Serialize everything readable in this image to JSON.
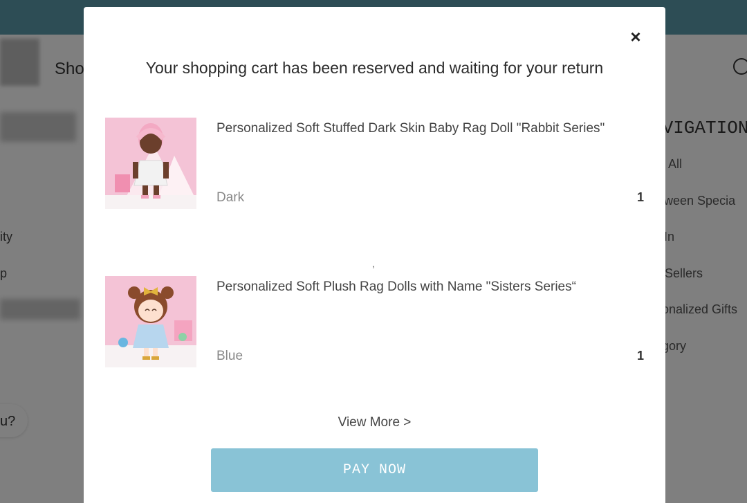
{
  "background": {
    "shop_label": "Sho",
    "left_links": [
      "ity",
      "p"
    ],
    "chat_text": "u?",
    "nav_heading": "AVIGATION",
    "nav_items": [
      "op All",
      "lloween Specia",
      "w In",
      "st Sellers",
      "rsonalized Gifts",
      "tegory"
    ]
  },
  "modal": {
    "title": "Your shopping cart has been reserved and waiting for your return",
    "close_symbol": "×",
    "items": [
      {
        "name": "Personalized Soft Stuffed Dark Skin Baby Rag Doll \"Rabbit Series\"",
        "variant": "Dark",
        "qty": "1"
      },
      {
        "name": "Personalized Soft Plush Rag Dolls with Name \"Sisters Series“",
        "variant": "Blue",
        "qty": "1"
      }
    ],
    "separator": ",",
    "view_more": "View More >",
    "pay_button": "PAY NOW"
  },
  "colors": {
    "topbar": "#5b9aaa",
    "pay_button": "#89c3d6",
    "thumb_background": "#f6c9da"
  }
}
